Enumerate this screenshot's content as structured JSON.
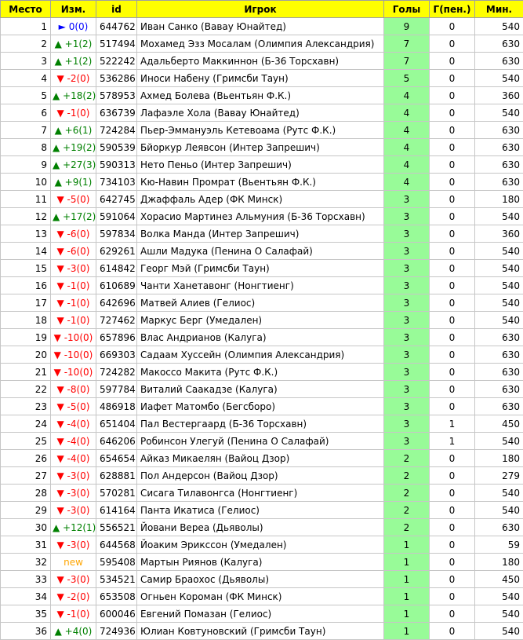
{
  "columns": [
    "Место",
    "Изм.",
    "id",
    "Игрок",
    "Голы",
    "Г(пен.)",
    "Мин."
  ],
  "rows": [
    {
      "place": "1",
      "change": "► 0(0)",
      "dir": "same",
      "id": "644762",
      "player": "Иван Санко (Вавау Юнайтед)",
      "goals": "9",
      "pen": "0",
      "mins": "540"
    },
    {
      "place": "2",
      "change": "▲ +1(2)",
      "dir": "up",
      "id": "517494",
      "player": "Мохамед Эзз Мосалам (Олимпия Александрия)",
      "goals": "7",
      "pen": "0",
      "mins": "630"
    },
    {
      "place": "3",
      "change": "▲ +1(2)",
      "dir": "up",
      "id": "522242",
      "player": "Адальберто Маккиннон (Б-36 Торсхавн)",
      "goals": "7",
      "pen": "0",
      "mins": "630"
    },
    {
      "place": "4",
      "change": "▼ -2(0)",
      "dir": "down",
      "id": "536286",
      "player": "Иноси Набену (Гримсби Таун)",
      "goals": "5",
      "pen": "0",
      "mins": "540"
    },
    {
      "place": "5",
      "change": "▲ +18(2)",
      "dir": "up",
      "id": "578953",
      "player": "Ахмед Болева (Вьентьян Ф.К.)",
      "goals": "4",
      "pen": "0",
      "mins": "360"
    },
    {
      "place": "6",
      "change": "▼ -1(0)",
      "dir": "down",
      "id": "636739",
      "player": "Лафаэле Хола (Вавау Юнайтед)",
      "goals": "4",
      "pen": "0",
      "mins": "540"
    },
    {
      "place": "7",
      "change": "▲ +6(1)",
      "dir": "up",
      "id": "724284",
      "player": "Пьер-Эммануэль Кетевоама (Рутс Ф.К.)",
      "goals": "4",
      "pen": "0",
      "mins": "630"
    },
    {
      "place": "8",
      "change": "▲ +19(2)",
      "dir": "up",
      "id": "590539",
      "player": "Бйоркур Леявсон (Интер Запрешич)",
      "goals": "4",
      "pen": "0",
      "mins": "630"
    },
    {
      "place": "9",
      "change": "▲ +27(3)",
      "dir": "up",
      "id": "590313",
      "player": "Нето Пеньо (Интер Запрешич)",
      "goals": "4",
      "pen": "0",
      "mins": "630"
    },
    {
      "place": "10",
      "change": "▲ +9(1)",
      "dir": "up",
      "id": "734103",
      "player": "Кю-Навин Промрат (Вьентьян Ф.К.)",
      "goals": "4",
      "pen": "0",
      "mins": "630"
    },
    {
      "place": "11",
      "change": "▼ -5(0)",
      "dir": "down",
      "id": "642745",
      "player": "Джаффаль Адер (ФК Минск)",
      "goals": "3",
      "pen": "0",
      "mins": "180"
    },
    {
      "place": "12",
      "change": "▲ +17(2)",
      "dir": "up",
      "id": "591064",
      "player": "Хорасио Мартинез Альмуния (Б-36 Торсхавн)",
      "goals": "3",
      "pen": "0",
      "mins": "540"
    },
    {
      "place": "13",
      "change": "▼ -6(0)",
      "dir": "down",
      "id": "597834",
      "player": "Волка Манда (Интер Запрешич)",
      "goals": "3",
      "pen": "0",
      "mins": "360"
    },
    {
      "place": "14",
      "change": "▼ -6(0)",
      "dir": "down",
      "id": "629261",
      "player": "Ашли Мадука (Пенина О Салафай)",
      "goals": "3",
      "pen": "0",
      "mins": "540"
    },
    {
      "place": "15",
      "change": "▼ -3(0)",
      "dir": "down",
      "id": "614842",
      "player": "Георг Мэй (Гримсби Таун)",
      "goals": "3",
      "pen": "0",
      "mins": "540"
    },
    {
      "place": "16",
      "change": "▼ -1(0)",
      "dir": "down",
      "id": "610689",
      "player": "Чанти Ханетавонг (Нонгтиенг)",
      "goals": "3",
      "pen": "0",
      "mins": "540"
    },
    {
      "place": "17",
      "change": "▼ -1(0)",
      "dir": "down",
      "id": "642696",
      "player": "Матвей Алиев (Гелиос)",
      "goals": "3",
      "pen": "0",
      "mins": "540"
    },
    {
      "place": "18",
      "change": "▼ -1(0)",
      "dir": "down",
      "id": "727462",
      "player": "Маркус Берг (Умедален)",
      "goals": "3",
      "pen": "0",
      "mins": "540"
    },
    {
      "place": "19",
      "change": "▼ -10(0)",
      "dir": "down",
      "id": "657896",
      "player": "Влас Андрианов (Калуга)",
      "goals": "3",
      "pen": "0",
      "mins": "630"
    },
    {
      "place": "20",
      "change": "▼ -10(0)",
      "dir": "down",
      "id": "669303",
      "player": "Садаам Хуссейн (Олимпия Александрия)",
      "goals": "3",
      "pen": "0",
      "mins": "630"
    },
    {
      "place": "21",
      "change": "▼ -10(0)",
      "dir": "down",
      "id": "724282",
      "player": "Макоссо Макита (Рутс Ф.К.)",
      "goals": "3",
      "pen": "0",
      "mins": "630"
    },
    {
      "place": "22",
      "change": "▼ -8(0)",
      "dir": "down",
      "id": "597784",
      "player": "Виталий Саакадзе (Калуга)",
      "goals": "3",
      "pen": "0",
      "mins": "630"
    },
    {
      "place": "23",
      "change": "▼ -5(0)",
      "dir": "down",
      "id": "486918",
      "player": "Иафет Матомбо (Бегсборо)",
      "goals": "3",
      "pen": "0",
      "mins": "630"
    },
    {
      "place": "24",
      "change": "▼ -4(0)",
      "dir": "down",
      "id": "651404",
      "player": "Пал Вестергаард (Б-36 Торсхавн)",
      "goals": "3",
      "pen": "1",
      "mins": "450"
    },
    {
      "place": "25",
      "change": "▼ -4(0)",
      "dir": "down",
      "id": "646206",
      "player": "Робинсон Улегуй (Пенина О Салафай)",
      "goals": "3",
      "pen": "1",
      "mins": "540"
    },
    {
      "place": "26",
      "change": "▼ -4(0)",
      "dir": "down",
      "id": "654654",
      "player": "Айказ Микаелян (Вайоц Дзор)",
      "goals": "2",
      "pen": "0",
      "mins": "180"
    },
    {
      "place": "27",
      "change": "▼ -3(0)",
      "dir": "down",
      "id": "628881",
      "player": "Пол Андерсон (Вайоц Дзор)",
      "goals": "2",
      "pen": "0",
      "mins": "279"
    },
    {
      "place": "28",
      "change": "▼ -3(0)",
      "dir": "down",
      "id": "570281",
      "player": "Сисага Тилавонгса (Нонгтиенг)",
      "goals": "2",
      "pen": "0",
      "mins": "540"
    },
    {
      "place": "29",
      "change": "▼ -3(0)",
      "dir": "down",
      "id": "614164",
      "player": "Панта Икатиса (Гелиос)",
      "goals": "2",
      "pen": "0",
      "mins": "540"
    },
    {
      "place": "30",
      "change": "▲ +12(1)",
      "dir": "up",
      "id": "556521",
      "player": "Йовани Вереа (Дьяволы)",
      "goals": "2",
      "pen": "0",
      "mins": "630"
    },
    {
      "place": "31",
      "change": "▼ -3(0)",
      "dir": "down",
      "id": "644568",
      "player": "Йоаким Эрикссон (Умедален)",
      "goals": "1",
      "pen": "0",
      "mins": "59"
    },
    {
      "place": "32",
      "change": "new",
      "dir": "new",
      "id": "595408",
      "player": "Мартын Риянов (Калуга)",
      "goals": "1",
      "pen": "0",
      "mins": "180"
    },
    {
      "place": "33",
      "change": "▼ -3(0)",
      "dir": "down",
      "id": "534521",
      "player": "Самир Браохос (Дьяволы)",
      "goals": "1",
      "pen": "0",
      "mins": "450"
    },
    {
      "place": "34",
      "change": "▼ -2(0)",
      "dir": "down",
      "id": "653508",
      "player": "Огньен Короман (ФК Минск)",
      "goals": "1",
      "pen": "0",
      "mins": "540"
    },
    {
      "place": "35",
      "change": "▼ -1(0)",
      "dir": "down",
      "id": "600046",
      "player": "Евгений Помазан (Гелиос)",
      "goals": "1",
      "pen": "0",
      "mins": "540"
    },
    {
      "place": "36",
      "change": "▲ +4(0)",
      "dir": "up",
      "id": "724936",
      "player": "Юлиан Ковтуновский (Гримсби Таун)",
      "goals": "1",
      "pen": "0",
      "mins": "540"
    }
  ]
}
